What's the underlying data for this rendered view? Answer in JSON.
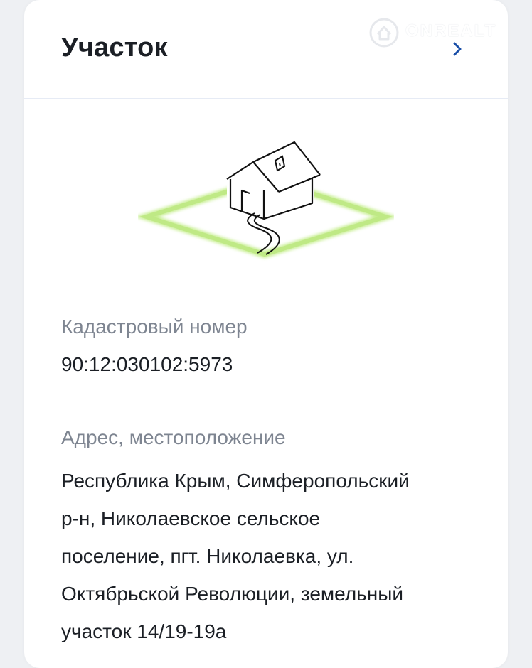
{
  "card": {
    "title": "Участок",
    "watermark": "ONREALT",
    "cadastral": {
      "label": "Кадастровый номер",
      "value": "90:12:030102:5973"
    },
    "address": {
      "label": "Адрес, местоположение",
      "lines": [
        "Республика Крым, Симферопольский",
        "р-н, Николаевское сельское",
        "поселение, пгт. Николаевка, ул.",
        "Октябрьской Революции, земельный",
        "участок 14/19-19а"
      ]
    }
  },
  "colors": {
    "accent": "#1a4fa8",
    "plot_outline": "#c6ee8f",
    "text_primary": "#1b1f25",
    "text_secondary": "#7e8591"
  },
  "icons": {
    "chevron": "chevron-right-icon",
    "illustration": "house-plot-icon",
    "watermark": "onrealt-logo"
  }
}
